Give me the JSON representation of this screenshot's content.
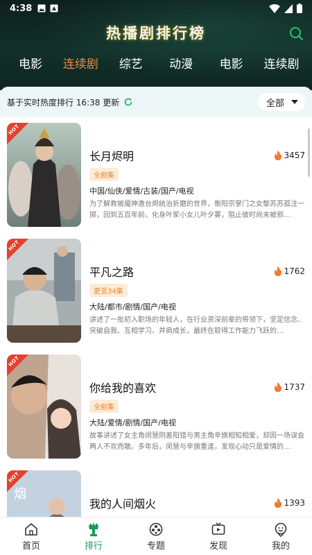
{
  "status_bar": {
    "time": "4:38"
  },
  "header": {
    "title": "热播剧排行榜",
    "category_tabs": [
      {
        "label": "电影",
        "active": false
      },
      {
        "label": "连续剧",
        "active": true
      },
      {
        "label": "综艺",
        "active": false
      },
      {
        "label": "动漫",
        "active": false
      },
      {
        "label": "电影",
        "active": false
      },
      {
        "label": "连续剧",
        "active": false
      }
    ]
  },
  "update_bar": {
    "text": "基于实时热度排行 16:38 更新",
    "filter_label": "全部"
  },
  "shows": [
    {
      "hot_label": "HOT",
      "title": "长月烬明",
      "heat": "3457",
      "badge": "全剧集",
      "genre": "中国/仙侠/爱情/古装/国产/电视",
      "desc": "为了解救被魇神澹台烬统治折磨的世界，衡阳宗掌门之女黎苏苏孤注一掷，回到五百年前，化身叶家小女儿叶夕雾，阻止彼时尚未被邪…"
    },
    {
      "hot_label": "HOT",
      "title": "平凡之路",
      "heat": "1762",
      "badge": "更至34集",
      "genre": "大陆/都市/剧情/国产/电视",
      "desc": "讲述了一批初入职场的年轻人，在行业资深前辈的带领下，坚定信念、突破自我、互相学习、并肩成长，最终在取得工作能力飞跃的…"
    },
    {
      "hot_label": "HOT",
      "title": "你给我的喜欢",
      "heat": "1737",
      "badge": "全剧集",
      "genre": "大陆/爱情/剧情/国产/电视",
      "desc": "故事讲述了女主角闵慧阴差阳错与男主角辛旗相知相爱，却因一场误会两人不欢而散。多年后，闵慧与辛旗重逢，发现心动只是爱情的…"
    },
    {
      "hot_label": "HOT",
      "title": "我的人间烟火",
      "heat": "1393",
      "badge": "",
      "genre": "",
      "desc": ""
    }
  ],
  "bottom_nav": [
    {
      "label": "首页",
      "icon": "home-icon",
      "active": false
    },
    {
      "label": "排行",
      "icon": "ranking-icon",
      "active": true
    },
    {
      "label": "专题",
      "icon": "topic-icon",
      "active": false
    },
    {
      "label": "发现",
      "icon": "tv-icon",
      "active": false
    },
    {
      "label": "我的",
      "icon": "profile-icon",
      "active": false
    }
  ],
  "colors": {
    "accent_orange": "#f08a3c",
    "active_green": "#1a9a5a",
    "header_bg": "#12302a",
    "badge_bg": "#fdebd8",
    "badge_text": "#e68a2e"
  }
}
